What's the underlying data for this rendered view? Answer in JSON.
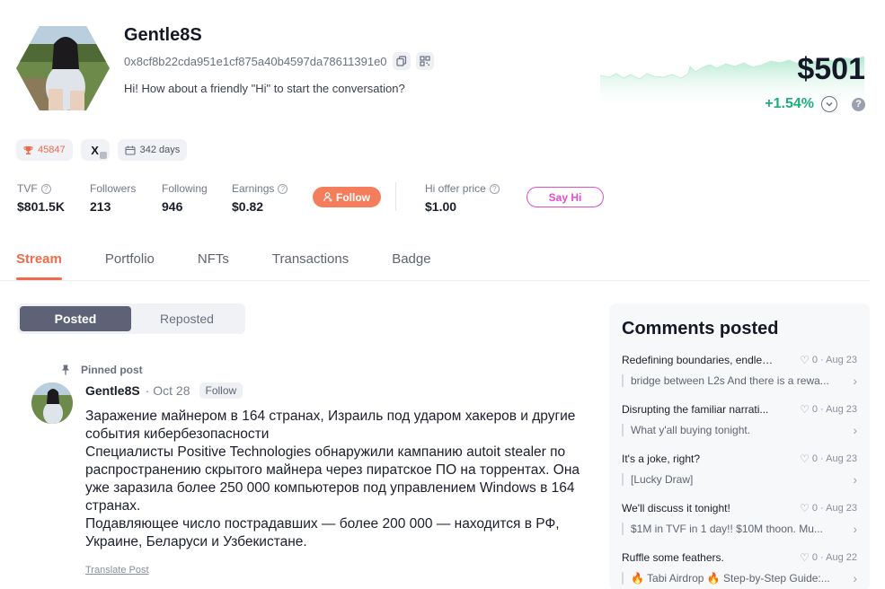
{
  "profile": {
    "name": "Gentle8S",
    "address": "0x8cf8b22cda951e1cf875a40b4597da78611391e0",
    "bio": "Hi! How about a friendly \"Hi\" to start the conversation?",
    "price": "$501",
    "change": "+1.54%",
    "accent_color": "#f26a47",
    "positive_color": "#1fae7a"
  },
  "badges": {
    "trophy_count": "45847",
    "x_label": "X",
    "days": "342 days"
  },
  "stats": {
    "tvf_label": "TVF",
    "tvf_value": "$801.5K",
    "followers_label": "Followers",
    "followers_value": "213",
    "following_label": "Following",
    "following_value": "946",
    "earnings_label": "Earnings",
    "earnings_value": "$0.82",
    "follow_button": "Follow",
    "hi_offer_label": "Hi offer price",
    "hi_offer_value": "$1.00",
    "say_hi_button": "Say Hi"
  },
  "tabs": [
    {
      "label": "Stream"
    },
    {
      "label": "Portfolio"
    },
    {
      "label": "NFTs"
    },
    {
      "label": "Transactions"
    },
    {
      "label": "Badge"
    }
  ],
  "feed_toggle": {
    "posted": "Posted",
    "reposted": "Reposted"
  },
  "post": {
    "pinned_label": "Pinned post",
    "author": "Gentle8S",
    "date": "· Oct 28",
    "follow_label": "Follow",
    "paragraphs": [
      "Заражение майнером в 164 странах, Израиль под ударом хакеров и другие события кибербезопасности",
      "Специалисты Positive Technologies обнаружили кампанию autoit stealer по распространению скрытого майнера через пиратское ПО на торрентах. Она уже заразила более 250 000 компьютеров под управлением Windows в 164 странах.",
      "Подавляющее число пострадавших — более 200 000 — находится в РФ, Украине, Беларуси и Узбекистане."
    ],
    "translate_label": "Translate Post"
  },
  "comments": {
    "title": "Comments posted",
    "items": [
      {
        "title": "Redefining boundaries, endless...",
        "likes": "0",
        "date": "· Aug 23",
        "quote": "bridge between L2s And there is a rewa..."
      },
      {
        "title": "Disrupting the familiar narrati...",
        "likes": "0",
        "date": "· Aug 23",
        "quote": "What y'all buying tonight."
      },
      {
        "title": "It's a joke, right?",
        "likes": "0",
        "date": "· Aug 23",
        "quote": "[Lucky Draw]"
      },
      {
        "title": "We'll discuss it tonight!",
        "likes": "0",
        "date": "· Aug 23",
        "quote": "$1M in TVF in 1 day!! $10M thoon. Mu..."
      },
      {
        "title": "Ruffle some feathers.",
        "likes": "0",
        "date": "· Aug 22",
        "quote": "🔥 Tabi Airdrop 🔥 Step-by-Step Guide:..."
      }
    ]
  }
}
